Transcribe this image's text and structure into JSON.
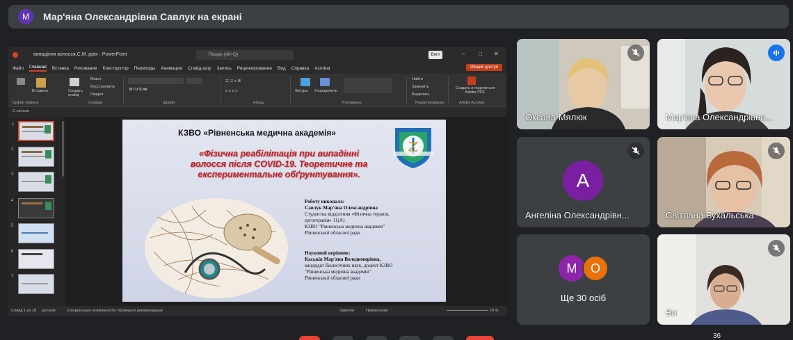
{
  "banner": {
    "avatar_letter": "M",
    "title": "Мар'яна Олександрівна Савлук на екрані"
  },
  "ppt": {
    "filename": "випадіння волосся,С.М..pptx  ·  PowerPoint",
    "search_placeholder": "Пошук (Alt+Q)",
    "view_label": "Вигл",
    "menu": [
      "Файл",
      "Главная",
      "Вставка",
      "Рисование",
      "Конструктор",
      "Переходы",
      "Анимация",
      "Слайд-шоу",
      "Запись",
      "Рецензирование",
      "Вид",
      "Справка",
      "Acrobat"
    ],
    "share_label": "Общий доступ",
    "ribbon_groups": [
      "Буфер обмена",
      "Слайды",
      "Шрифт",
      "Абзац",
      "Рисование",
      "Редактирование",
      "Adobe Acrobat"
    ],
    "ribbon_buttons": {
      "paste": "Вставить",
      "new_slide": "Создать слайд",
      "layout": "Макет",
      "reset": "Восстановить",
      "section": "Раздел",
      "shapes": "Фигуры",
      "arrange": "Упорядочить",
      "find": "Найти",
      "replace": "Заменить",
      "select": "Выделить",
      "acrobat": "Создать и поделиться Adobe PDF"
    },
    "subbar": "С начала",
    "status_left": "Слайд 1 из 18",
    "status_lang": "русский",
    "status_access": "Специальные возможности: проверьте рекомендации",
    "status_notes": "Заметки",
    "status_comments": "Примечания",
    "zoom": "78 %",
    "thumb_numbers": [
      "1",
      "2",
      "3",
      "4",
      "5",
      "6",
      "7"
    ]
  },
  "slide": {
    "header": "КЗВО «Рівненська медична академія»",
    "title_lines": [
      "«Фізична реабілітація при випадінні",
      "волосся після  COVID-19. Теоретичне та",
      "експериментальне обґрунтування»."
    ],
    "author_block": [
      "Роботу  виконала:",
      "Савлук Мар'яна Олександрівна",
      "Студентка  відділення  «Фізична  терапія,",
      "ерготерапія» 11(А)",
      "КЗВО \"Рівненська медична академія\"",
      "Рівненської обласної ради"
    ],
    "supervisor_block": [
      "Науковий керівник:",
      "Каськів Мар'яна Володимирівна,",
      "кандидат  біологічних  наук,  доцент  КЗВО",
      "\"Рівненська медична академія\"",
      "Рівненської обласної ради"
    ]
  },
  "participants": [
    {
      "name": "Оксана Мялюк",
      "muted": true
    },
    {
      "name": "Мар'яна Олександрівна...",
      "speaking": true
    },
    {
      "name": "Ангеліна Олександрівн...",
      "letter": "A",
      "muted": true
    },
    {
      "name": "Світлана Бухальська",
      "muted": true
    },
    {
      "more_letters": [
        "M",
        "O"
      ],
      "label": "Ще 30 осіб"
    },
    {
      "name": "Ви",
      "muted": true
    }
  ],
  "participant_count": "36",
  "colors": {
    "accent": "#8ab4f8",
    "slide_title": "#b82424",
    "ppt_accent": "#d04423"
  }
}
